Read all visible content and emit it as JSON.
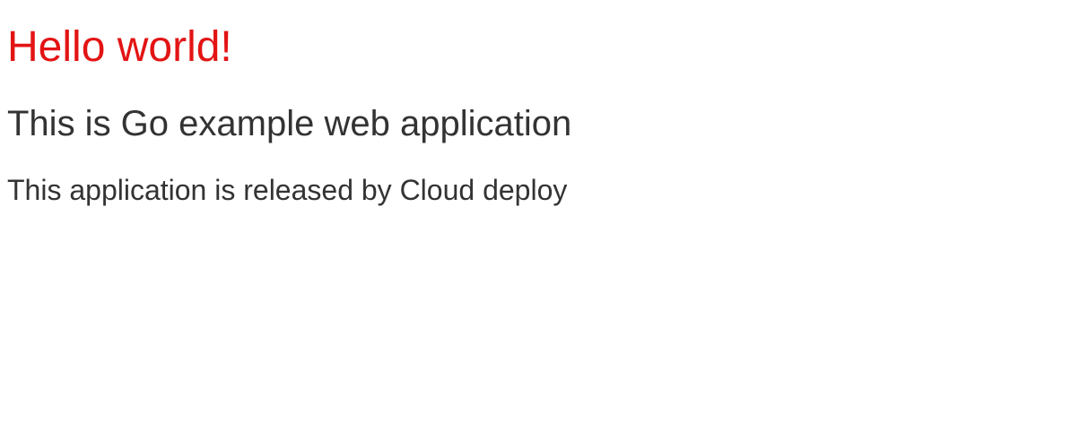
{
  "page": {
    "title": "Hello world!",
    "subtitle": "This is Go example web application",
    "description": "This application is released by Cloud deploy"
  },
  "colors": {
    "title": "#e31414",
    "text": "#333333",
    "background": "#ffffff"
  }
}
